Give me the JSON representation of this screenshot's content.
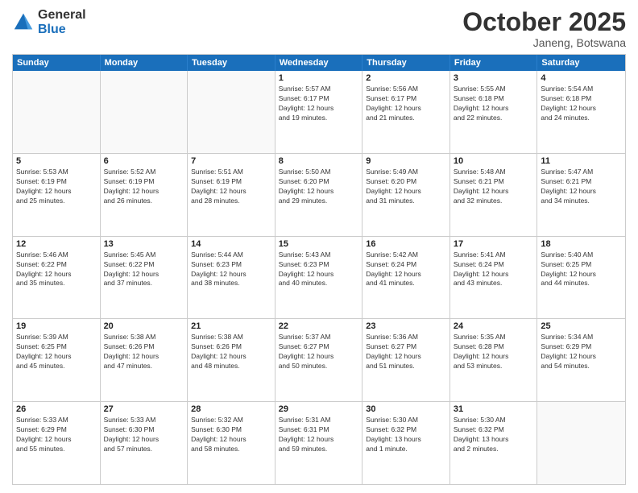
{
  "logo": {
    "general": "General",
    "blue": "Blue"
  },
  "header": {
    "month": "October 2025",
    "location": "Janeng, Botswana"
  },
  "weekdays": [
    "Sunday",
    "Monday",
    "Tuesday",
    "Wednesday",
    "Thursday",
    "Friday",
    "Saturday"
  ],
  "rows": [
    [
      {
        "day": "",
        "info": ""
      },
      {
        "day": "",
        "info": ""
      },
      {
        "day": "",
        "info": ""
      },
      {
        "day": "1",
        "info": "Sunrise: 5:57 AM\nSunset: 6:17 PM\nDaylight: 12 hours\nand 19 minutes."
      },
      {
        "day": "2",
        "info": "Sunrise: 5:56 AM\nSunset: 6:17 PM\nDaylight: 12 hours\nand 21 minutes."
      },
      {
        "day": "3",
        "info": "Sunrise: 5:55 AM\nSunset: 6:18 PM\nDaylight: 12 hours\nand 22 minutes."
      },
      {
        "day": "4",
        "info": "Sunrise: 5:54 AM\nSunset: 6:18 PM\nDaylight: 12 hours\nand 24 minutes."
      }
    ],
    [
      {
        "day": "5",
        "info": "Sunrise: 5:53 AM\nSunset: 6:19 PM\nDaylight: 12 hours\nand 25 minutes."
      },
      {
        "day": "6",
        "info": "Sunrise: 5:52 AM\nSunset: 6:19 PM\nDaylight: 12 hours\nand 26 minutes."
      },
      {
        "day": "7",
        "info": "Sunrise: 5:51 AM\nSunset: 6:19 PM\nDaylight: 12 hours\nand 28 minutes."
      },
      {
        "day": "8",
        "info": "Sunrise: 5:50 AM\nSunset: 6:20 PM\nDaylight: 12 hours\nand 29 minutes."
      },
      {
        "day": "9",
        "info": "Sunrise: 5:49 AM\nSunset: 6:20 PM\nDaylight: 12 hours\nand 31 minutes."
      },
      {
        "day": "10",
        "info": "Sunrise: 5:48 AM\nSunset: 6:21 PM\nDaylight: 12 hours\nand 32 minutes."
      },
      {
        "day": "11",
        "info": "Sunrise: 5:47 AM\nSunset: 6:21 PM\nDaylight: 12 hours\nand 34 minutes."
      }
    ],
    [
      {
        "day": "12",
        "info": "Sunrise: 5:46 AM\nSunset: 6:22 PM\nDaylight: 12 hours\nand 35 minutes."
      },
      {
        "day": "13",
        "info": "Sunrise: 5:45 AM\nSunset: 6:22 PM\nDaylight: 12 hours\nand 37 minutes."
      },
      {
        "day": "14",
        "info": "Sunrise: 5:44 AM\nSunset: 6:23 PM\nDaylight: 12 hours\nand 38 minutes."
      },
      {
        "day": "15",
        "info": "Sunrise: 5:43 AM\nSunset: 6:23 PM\nDaylight: 12 hours\nand 40 minutes."
      },
      {
        "day": "16",
        "info": "Sunrise: 5:42 AM\nSunset: 6:24 PM\nDaylight: 12 hours\nand 41 minutes."
      },
      {
        "day": "17",
        "info": "Sunrise: 5:41 AM\nSunset: 6:24 PM\nDaylight: 12 hours\nand 43 minutes."
      },
      {
        "day": "18",
        "info": "Sunrise: 5:40 AM\nSunset: 6:25 PM\nDaylight: 12 hours\nand 44 minutes."
      }
    ],
    [
      {
        "day": "19",
        "info": "Sunrise: 5:39 AM\nSunset: 6:25 PM\nDaylight: 12 hours\nand 45 minutes."
      },
      {
        "day": "20",
        "info": "Sunrise: 5:38 AM\nSunset: 6:26 PM\nDaylight: 12 hours\nand 47 minutes."
      },
      {
        "day": "21",
        "info": "Sunrise: 5:38 AM\nSunset: 6:26 PM\nDaylight: 12 hours\nand 48 minutes."
      },
      {
        "day": "22",
        "info": "Sunrise: 5:37 AM\nSunset: 6:27 PM\nDaylight: 12 hours\nand 50 minutes."
      },
      {
        "day": "23",
        "info": "Sunrise: 5:36 AM\nSunset: 6:27 PM\nDaylight: 12 hours\nand 51 minutes."
      },
      {
        "day": "24",
        "info": "Sunrise: 5:35 AM\nSunset: 6:28 PM\nDaylight: 12 hours\nand 53 minutes."
      },
      {
        "day": "25",
        "info": "Sunrise: 5:34 AM\nSunset: 6:29 PM\nDaylight: 12 hours\nand 54 minutes."
      }
    ],
    [
      {
        "day": "26",
        "info": "Sunrise: 5:33 AM\nSunset: 6:29 PM\nDaylight: 12 hours\nand 55 minutes."
      },
      {
        "day": "27",
        "info": "Sunrise: 5:33 AM\nSunset: 6:30 PM\nDaylight: 12 hours\nand 57 minutes."
      },
      {
        "day": "28",
        "info": "Sunrise: 5:32 AM\nSunset: 6:30 PM\nDaylight: 12 hours\nand 58 minutes."
      },
      {
        "day": "29",
        "info": "Sunrise: 5:31 AM\nSunset: 6:31 PM\nDaylight: 12 hours\nand 59 minutes."
      },
      {
        "day": "30",
        "info": "Sunrise: 5:30 AM\nSunset: 6:32 PM\nDaylight: 13 hours\nand 1 minute."
      },
      {
        "day": "31",
        "info": "Sunrise: 5:30 AM\nSunset: 6:32 PM\nDaylight: 13 hours\nand 2 minutes."
      },
      {
        "day": "",
        "info": ""
      }
    ]
  ]
}
